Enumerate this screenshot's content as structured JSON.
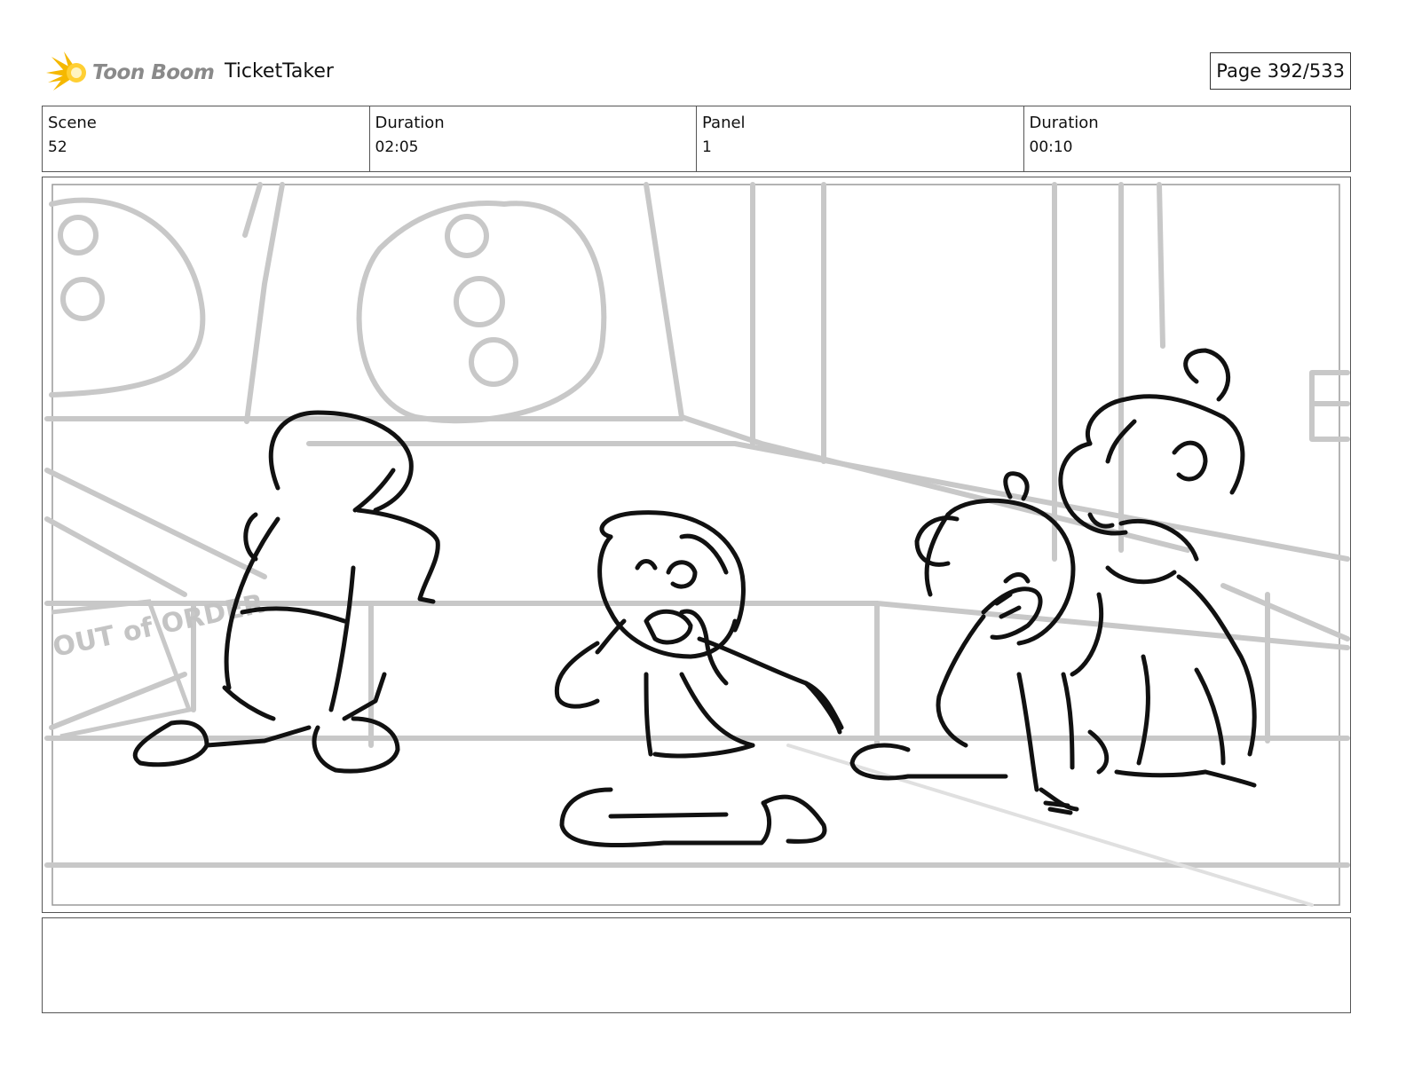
{
  "header": {
    "logo_text": "Toon Boom",
    "project_title": "TicketTaker",
    "page_indicator": "Page 392/533"
  },
  "info": {
    "scene_label": "Scene",
    "scene_value": "52",
    "scene_duration_label": "Duration",
    "scene_duration_value": "02:05",
    "panel_label": "Panel",
    "panel_value": "1",
    "panel_duration_label": "Duration",
    "panel_duration_value": "00:10"
  },
  "panel": {
    "sign_text": "OUT of ORDER"
  },
  "notes": {
    "text": ""
  },
  "colors": {
    "logo_accent": "#f5b800",
    "sketch_line": "#111111",
    "background_line": "#c8c8c8"
  }
}
